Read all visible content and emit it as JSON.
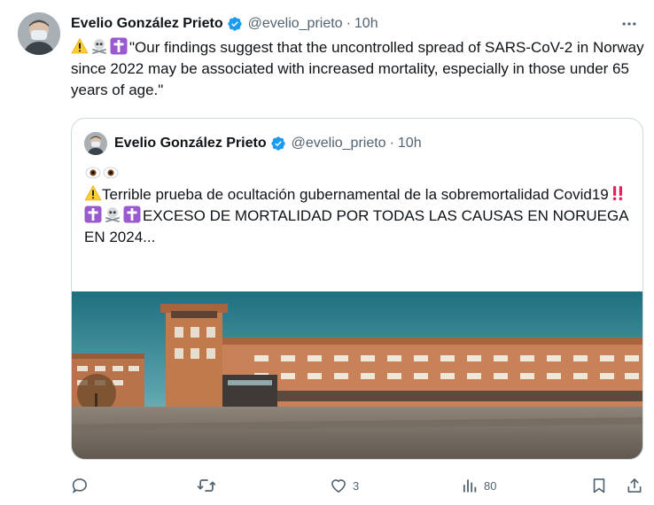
{
  "tweet": {
    "author_name": "Evelio González Prieto",
    "handle": "@evelio_prieto",
    "separator": "·",
    "time": "10h",
    "text": "\"Our findings suggest that the uncontrolled spread of SARS-CoV-2 in Norway since 2022 may be associated with increased mortality, especially in those under 65 years of age.\"",
    "emojis": [
      "warning",
      "skull-crossbones",
      "latin-cross"
    ]
  },
  "quote": {
    "author_name": "Evelio González Prieto",
    "handle": "@evelio_prieto",
    "separator": "·",
    "time": "10h",
    "line1_emojis": [
      "eye",
      "eye"
    ],
    "line2_text": "Terrible prueba de ocultación gubernamental de la sobremortalidad Covid19",
    "line3_text": "EXCESO DE MORTALIDAD POR TODAS LAS CAUSAS EN NORUEGA EN 2024..."
  },
  "actions": {
    "reply_count": "",
    "retweet_count": "",
    "like_count": "3",
    "views_count": "80"
  },
  "colors": {
    "text": "#0f1419",
    "secondary": "#536471",
    "verified": "#1d9bf0",
    "border": "#cfd9de"
  }
}
